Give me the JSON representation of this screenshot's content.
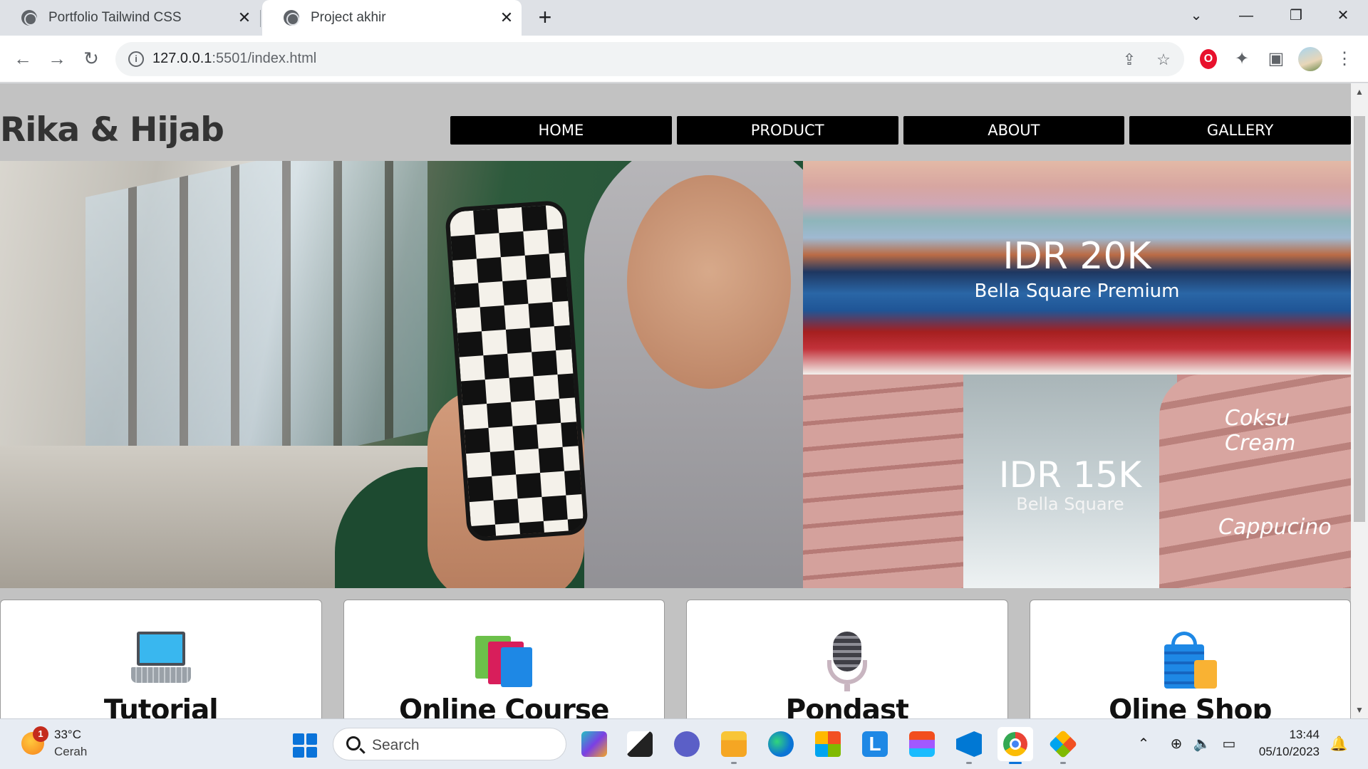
{
  "browser": {
    "tabs": [
      {
        "title": "Portfolio Tailwind CSS",
        "active": false
      },
      {
        "title": "Project akhir",
        "active": true
      }
    ],
    "url_host": "127.0.0.1",
    "url_rest": ":5501/index.html",
    "icons": [
      "back-arrow",
      "forward-arrow",
      "reload",
      "info",
      "share",
      "star",
      "opera",
      "extensions",
      "side-panel",
      "profile",
      "more"
    ]
  },
  "page": {
    "brand": "Rika & Hijab",
    "nav": [
      "HOME",
      "PRODUCT",
      "ABOUT",
      "GALLERY"
    ],
    "promos": [
      {
        "price": "IDR 20K",
        "name": "Bella Square Premium"
      },
      {
        "price": "IDR 15K",
        "name": "Bella Square",
        "colors": [
          "Coksu Cream",
          "Cappucino"
        ]
      }
    ],
    "cards": [
      {
        "title": "Tutorial",
        "icon": "laptop-icon"
      },
      {
        "title": "Online Course",
        "icon": "books-icon"
      },
      {
        "title": "Pondast",
        "icon": "microphone-icon"
      },
      {
        "title": "Oline Shop",
        "icon": "shopping-bag-icon"
      }
    ]
  },
  "taskbar": {
    "weather_temp": "33°C",
    "weather_condition": "Cerah",
    "weather_badge": "1",
    "search_label": "Search",
    "time": "13:44",
    "date": "05/10/2023",
    "colors": {
      "accent": "#0a73d9"
    }
  }
}
